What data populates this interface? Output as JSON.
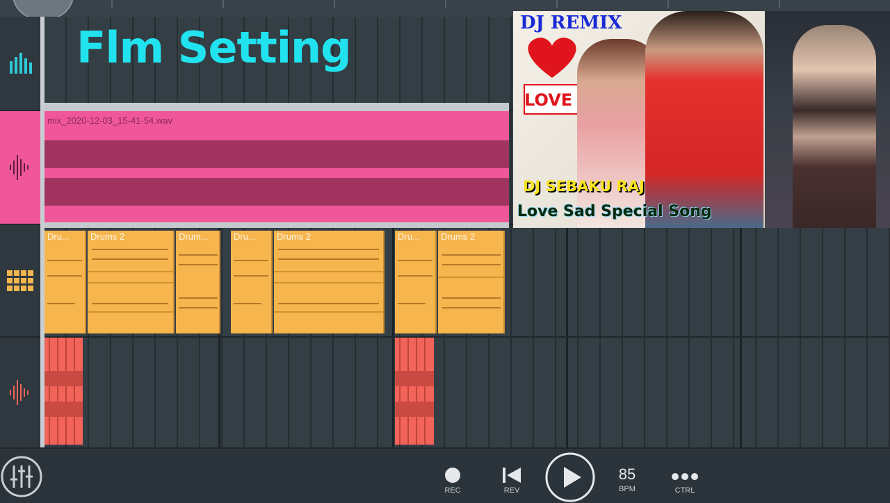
{
  "overlay": {
    "title": "Flm Setting"
  },
  "tracks": {
    "audio_clip": {
      "filename": "mix_2020-12-03_15-41-54.wav"
    },
    "drum_clips": [
      "Dru...",
      "Drums 2",
      "Drum...",
      "Dru...",
      "Drums 2",
      "Dru...",
      "Drums 2"
    ]
  },
  "poster": {
    "remix": "DJ REMIX",
    "love": "LOVE",
    "dj": "DJ SEBAKU RAJ",
    "song": "Love Sad Special Song"
  },
  "transport": {
    "rec": "REC",
    "rev": "REV",
    "bpm_value": "85",
    "bpm": "BPM",
    "ctrl": "CTRL"
  },
  "colors": {
    "accent": "#21e3ef",
    "audio": "#f0569a",
    "drum": "#f6b54d",
    "sample": "#f26459"
  }
}
